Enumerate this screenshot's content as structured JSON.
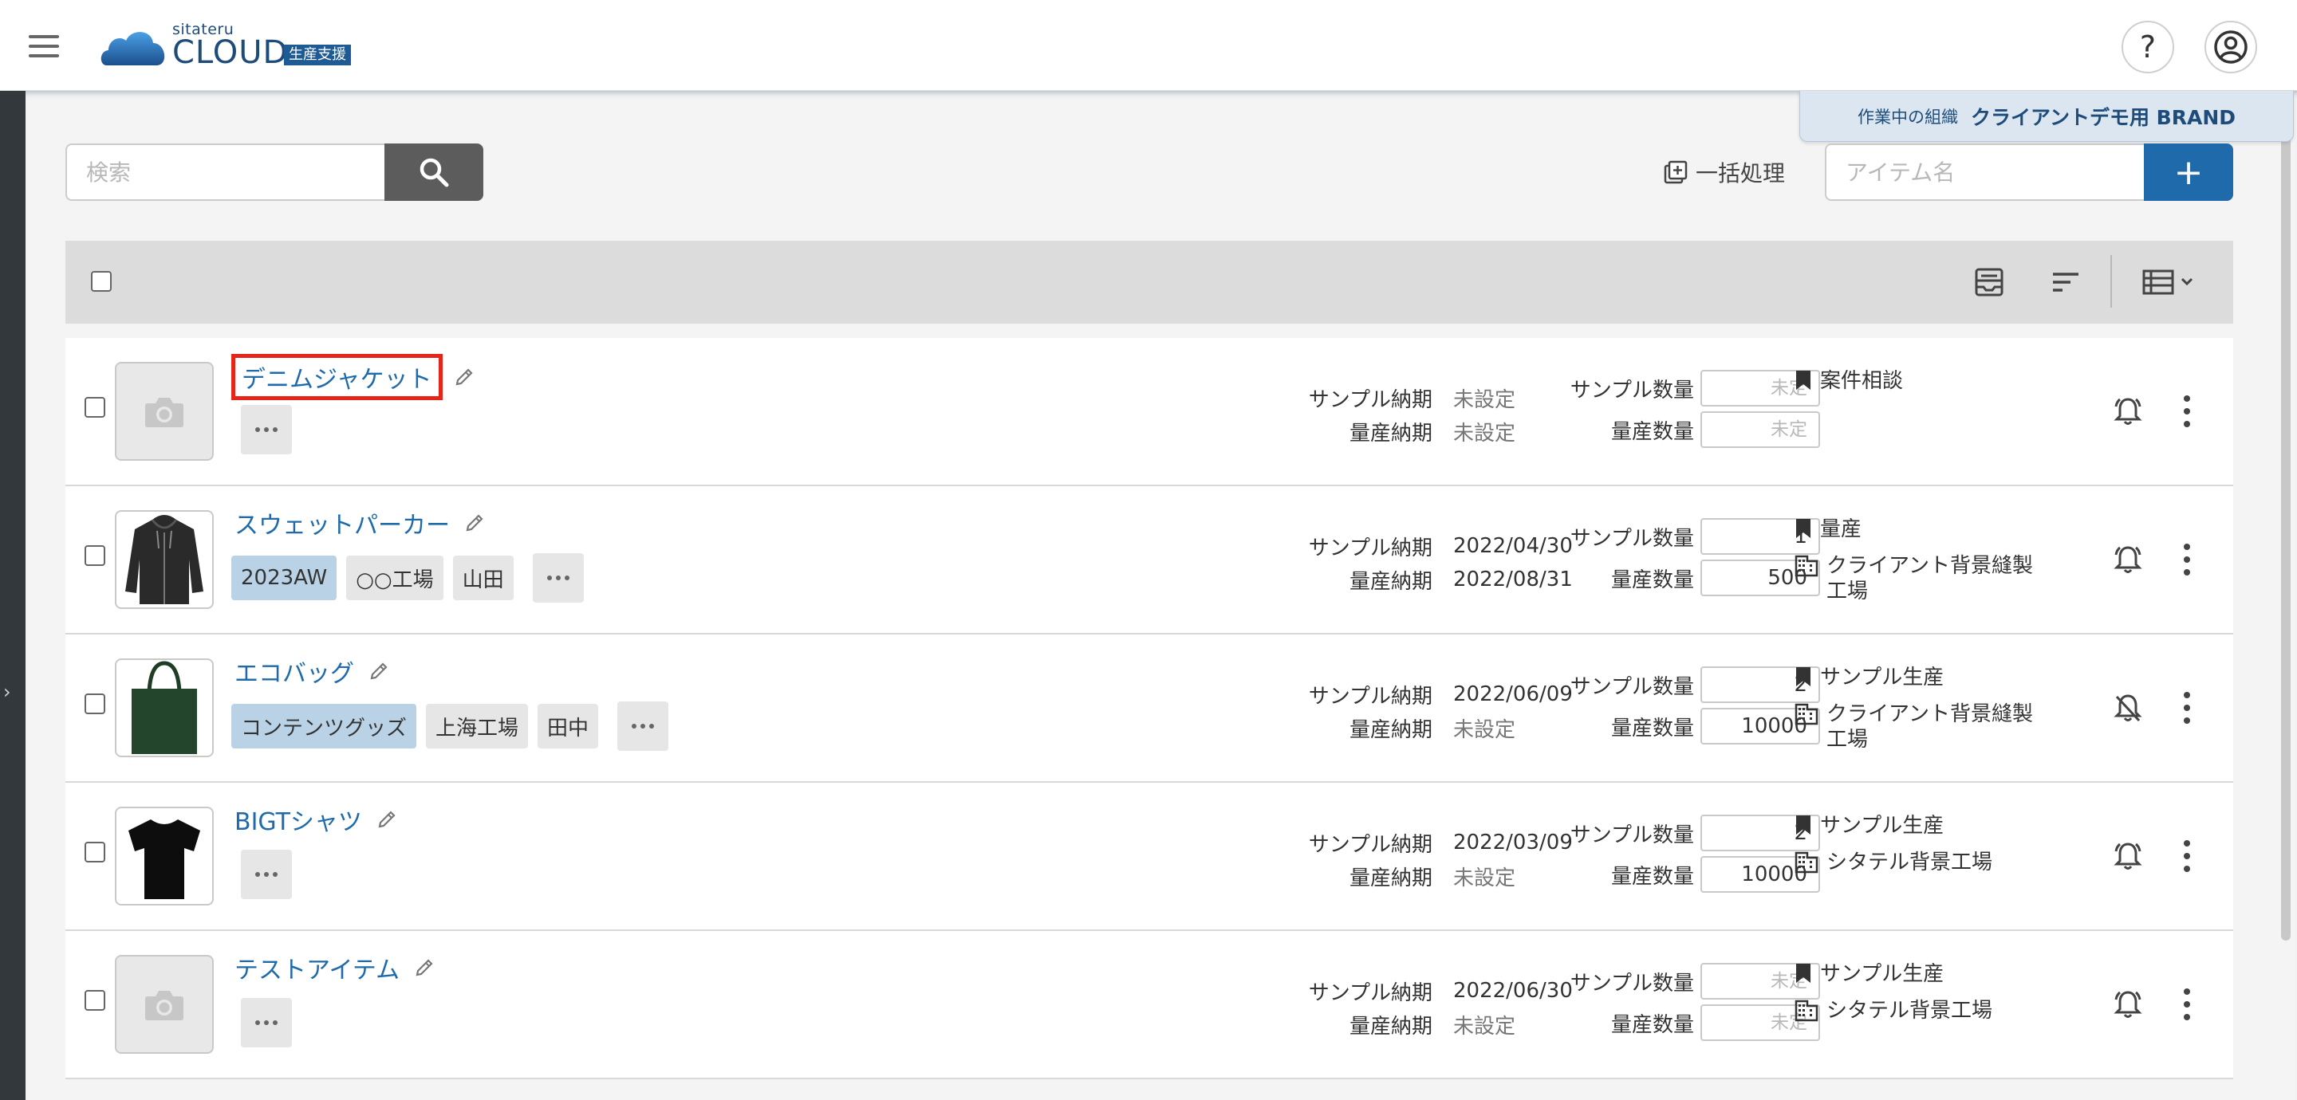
{
  "header": {
    "logo_small": "sitateru",
    "logo_big": "CLOUD",
    "logo_badge": "生産支援",
    "help_label": "?"
  },
  "org": {
    "label": "作業中の組織",
    "name": "クライアントデモ用 BRAND"
  },
  "search": {
    "placeholder": "検索"
  },
  "actions": {
    "bulk_label": "一括処理",
    "item_placeholder": "アイテム名",
    "add_label": "+"
  },
  "labels": {
    "sample_due": "サンプル納期",
    "mass_due": "量産納期",
    "sample_qty": "サンプル数量",
    "mass_qty": "量産数量"
  },
  "colors": {
    "accent": "#1e6aaa",
    "highlight": "#e5251a",
    "season_tag": "#b9d2e6"
  },
  "items": [
    {
      "name": "デニムジャケット",
      "image": "camera-placeholder-icon",
      "tags": [],
      "sample_due": "未設定",
      "mass_due": "未設定",
      "sample_qty": "未定",
      "mass_qty": "未定",
      "phase": "案件相談",
      "factory": "",
      "notify": "on"
    },
    {
      "name": "スウェットパーカー",
      "image": "hoodie-photo",
      "tags": [
        "2023AW",
        "○○工場",
        "山田"
      ],
      "sample_due": "2022/04/30",
      "mass_due": "2022/08/31",
      "sample_qty": "1",
      "mass_qty": "500",
      "phase": "量産",
      "factory": "クライアント背景縫製工場",
      "notify": "on"
    },
    {
      "name": "エコバッグ",
      "image": "tote-bag-photo",
      "tags": [
        "コンテンツグッズ",
        "上海工場",
        "田中"
      ],
      "sample_due": "2022/06/09",
      "mass_due": "未設定",
      "sample_qty": "2",
      "mass_qty": "10000",
      "phase": "サンプル生産",
      "factory": "クライアント背景縫製工場",
      "notify": "off"
    },
    {
      "name": "BIGTシャツ",
      "image": "tshirt-photo",
      "tags": [],
      "sample_due": "2022/03/09",
      "mass_due": "未設定",
      "sample_qty": "2",
      "mass_qty": "10000",
      "phase": "サンプル生産",
      "factory": "シタテル背景工場",
      "notify": "on"
    },
    {
      "name": "テストアイテム",
      "image": "camera-placeholder-icon",
      "tags": [],
      "sample_due": "2022/06/30",
      "mass_due": "未設定",
      "sample_qty": "未定",
      "mass_qty": "未定",
      "phase": "サンプル生産",
      "factory": "シタテル背景工場",
      "notify": "on"
    }
  ]
}
